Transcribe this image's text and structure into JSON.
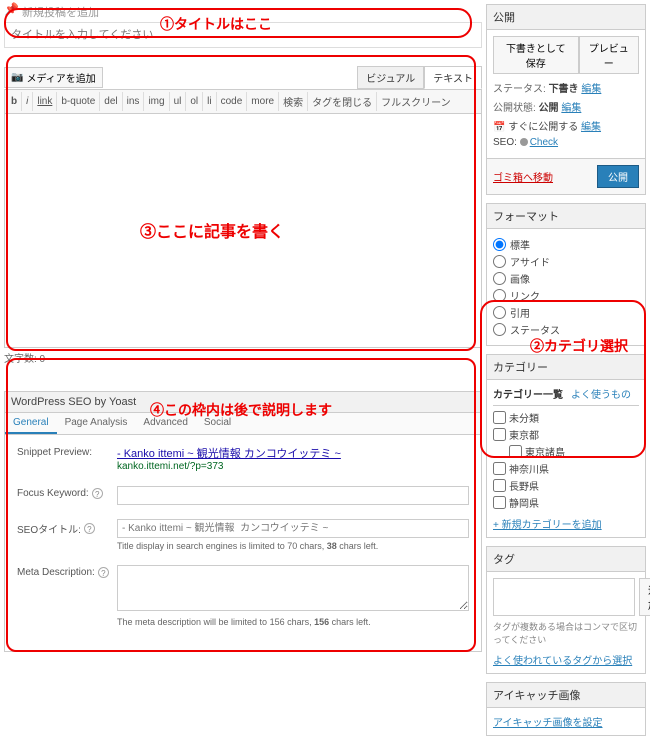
{
  "heading": "新規投稿を追加",
  "title_placeholder": "タイトルを入力してください",
  "annotations": {
    "a1": "①タイトルはここ",
    "a2": "②カテゴリ選択",
    "a3": "③ここに記事を書く",
    "a4": "④この枠内は後で説明します"
  },
  "media_button": "メディアを追加",
  "editor_tabs": {
    "visual": "ビジュアル",
    "text": "テキスト"
  },
  "toolbar": [
    "b",
    "i",
    "link",
    "b-quote",
    "del",
    "ins",
    "img",
    "ul",
    "ol",
    "li",
    "code",
    "more",
    "検索",
    "タグを閉じる",
    "フルスクリーン"
  ],
  "word_count": "文字数: 0",
  "seo": {
    "header": "WordPress SEO by Yoast",
    "tabs": [
      "General",
      "Page Analysis",
      "Advanced",
      "Social"
    ],
    "snippet_label": "Snippet Preview:",
    "snippet_title": "- Kanko ittemi ~ 観光情報  カンコウイッテミ ~",
    "snippet_url": "kanko.ittemi.net/?p=373",
    "focus_label": "Focus Keyword:",
    "seotitle_label": "SEOタイトル:",
    "seotitle_placeholder": "- Kanko ittemi ~ 観光情報  カンコウイッテミ ~",
    "seotitle_note_a": "Title display in search engines is limited to 70 chars, ",
    "seotitle_note_b": "38",
    "seotitle_note_c": " chars left.",
    "meta_label": "Meta Description:",
    "meta_note_a": "The  meta  description will be limited to 156 chars, ",
    "meta_note_b": "156",
    "meta_note_c": " chars left."
  },
  "publish": {
    "title": "公開",
    "save_draft": "下書きとして保存",
    "preview": "プレビュー",
    "status_label": "ステータス:",
    "status_val": "下書き",
    "edit": "編集",
    "visibility_label": "公開状態:",
    "visibility_val": "公開",
    "schedule_label": "すぐに公開する",
    "seo_label": "SEO:",
    "seo_check": "Check",
    "trash": "ゴミ箱へ移動",
    "publish_btn": "公開"
  },
  "format": {
    "title": "フォーマット",
    "items": [
      "標準",
      "アサイド",
      "画像",
      "リンク",
      "引用",
      "ステータス"
    ]
  },
  "categories": {
    "title": "カテゴリー",
    "tab_all": "カテゴリー一覧",
    "tab_used": "よく使うもの",
    "items": [
      {
        "label": "未分類",
        "indent": false
      },
      {
        "label": "東京都",
        "indent": false
      },
      {
        "label": "東京諸島",
        "indent": true
      },
      {
        "label": "神奈川県",
        "indent": false
      },
      {
        "label": "長野県",
        "indent": false
      },
      {
        "label": "静岡県",
        "indent": false
      }
    ],
    "add_new": "+ 新規カテゴリーを追加"
  },
  "tags": {
    "title": "タグ",
    "add_btn": "追加",
    "note": "タグが複数ある場合はコンマで区切ってください",
    "choose": "よく使われているタグから選択"
  },
  "featured": {
    "title": "アイキャッチ画像",
    "set": "アイキャッチ画像を設定"
  }
}
